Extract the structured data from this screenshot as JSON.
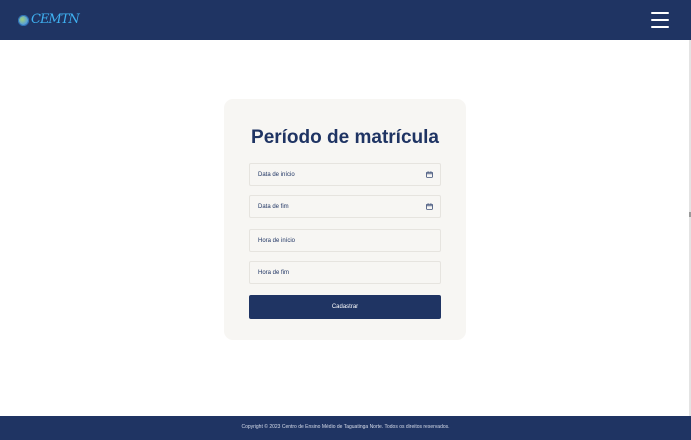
{
  "header": {
    "logo_text": "CEMTN",
    "menu_icon": "hamburger-menu-icon"
  },
  "form": {
    "title": "Período de matrícula",
    "fields": [
      {
        "label": "Data de início",
        "icon": "calendar-icon"
      },
      {
        "label": "Data de fim",
        "icon": "calendar-icon"
      },
      {
        "label": "Hora de início"
      },
      {
        "label": "Hora de fim"
      }
    ],
    "submit_label": "Cadastrar"
  },
  "footer": {
    "copyright": "Copyright © 2023 Centro de Ensino Médio de Taguatinga Norte. Todos os direitos reservados."
  },
  "colors": {
    "primary": "#1f3463",
    "card_bg": "#f7f6f3",
    "logo_accent": "#3fb0f0"
  }
}
